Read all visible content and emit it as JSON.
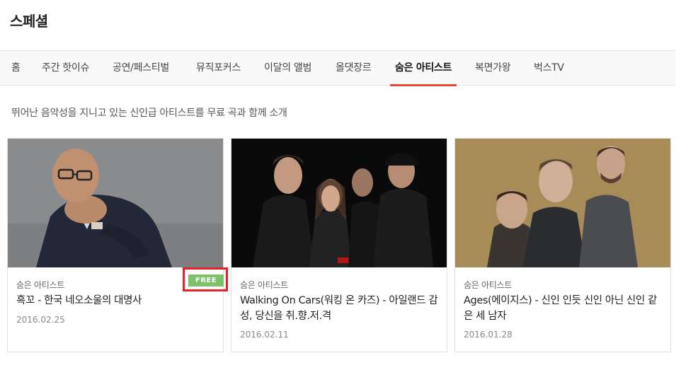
{
  "page": {
    "title": "스페셜",
    "description": "뛰어난 음악성을 지니고 있는 신인급 아티스트를 무료 곡과 함께 소개"
  },
  "tabs": [
    {
      "label": "홈",
      "active": false
    },
    {
      "label": "주간 핫이슈",
      "active": false
    },
    {
      "label": "공연/페스티벌",
      "active": false
    },
    {
      "label": "뮤직포커스",
      "active": false
    },
    {
      "label": "이달의 앨범",
      "active": false
    },
    {
      "label": "올댓장르",
      "active": false
    },
    {
      "label": "숨은 아티스트",
      "active": true
    },
    {
      "label": "복면가왕",
      "active": false
    },
    {
      "label": "벅스TV",
      "active": false
    }
  ],
  "cards": [
    {
      "category": "숨은 아티스트",
      "title": "흑꼬 - 한국 네오소울의 대명사",
      "date": "2016.02.25",
      "badge": "FREE",
      "image": "artist-photo-gray-background"
    },
    {
      "category": "숨은 아티스트",
      "title": "Walking On Cars(워킹 온 카즈) - 아일랜드 감성, 당신을 취.향.저.격",
      "date": "2016.02.11",
      "image": "band-photo-black-background"
    },
    {
      "category": "숨은 아티스트",
      "title": "Ages(에이지스) - 신인 인듯 신인 아닌 신인 같은 세 남자",
      "date": "2016.01.28",
      "image": "trio-photo-tan-background"
    }
  ],
  "colors": {
    "accent": "#e64a3b",
    "free_badge": "#7cc26a",
    "highlight": "#e8202a"
  }
}
